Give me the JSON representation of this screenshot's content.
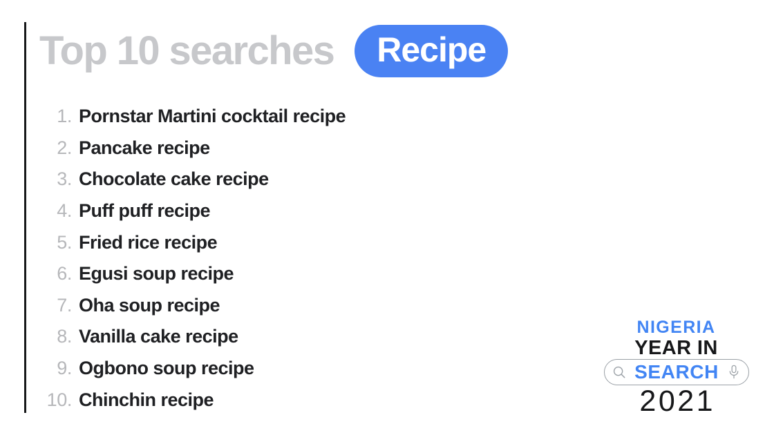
{
  "card": {
    "background_color": "#ffffff",
    "accent_rule_color": "#17181a"
  },
  "heading": {
    "title": "Top 10 searches",
    "title_color": "#c7c8cb",
    "category_label": "Recipe",
    "category_pill_color": "#4a82f3",
    "category_text_color": "#ffffff"
  },
  "list": {
    "number_color": "#b6b7ba",
    "label_color": "#1f2023",
    "items": [
      {
        "rank": "1.",
        "label": "Pornstar Martini cocktail recipe"
      },
      {
        "rank": "2.",
        "label": "Pancake recipe"
      },
      {
        "rank": "3.",
        "label": "Chocolate cake recipe"
      },
      {
        "rank": "4.",
        "label": "Puff puff recipe"
      },
      {
        "rank": "5.",
        "label": "Fried rice recipe"
      },
      {
        "rank": "6.",
        "label": "Egusi soup recipe"
      },
      {
        "rank": "7.",
        "label": "Oha soup recipe"
      },
      {
        "rank": "8.",
        "label": "Vanilla cake recipe"
      },
      {
        "rank": "9.",
        "label": "Ogbono soup recipe"
      },
      {
        "rank": "10.",
        "label": "Chinchin recipe"
      }
    ]
  },
  "brand": {
    "country": "NIGERIA",
    "country_color": "#4285f4",
    "year_in": "YEAR IN",
    "search": "SEARCH",
    "search_color": "#4285f4",
    "year": "2021",
    "year_color": "#17181a",
    "pill_border_color": "#9aa0a6",
    "icons": {
      "left": "search-icon",
      "right": "microphone-icon"
    }
  }
}
